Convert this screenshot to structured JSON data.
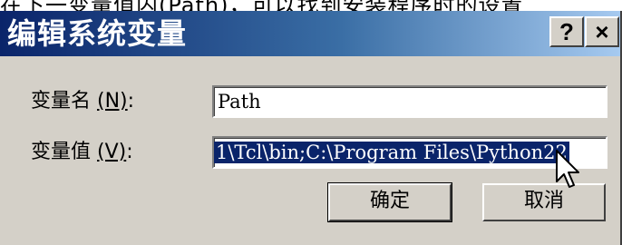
{
  "background_text": "在下一变量值内(Path)，可以找到安装程序时的设置",
  "dialog": {
    "title": "编辑系统变量",
    "help_label": "?",
    "close_label": "×"
  },
  "fields": {
    "name_label": "变量名",
    "name_mnemonic": "(N)",
    "name_colon": ":",
    "name_value": "Path",
    "value_label": "变量值",
    "value_mnemonic": "(V)",
    "value_colon": ":",
    "value_value": "1\\Tcl\\bin;C:\\Program Files\\Python22"
  },
  "buttons": {
    "ok": "确定",
    "cancel": "取消"
  },
  "colors": {
    "title_start": "#0a246a",
    "title_end": "#a6caf0",
    "selection": "#0a246a",
    "face": "#d4d0c8"
  },
  "icons": {
    "cursor": "mouse-pointer-icon"
  }
}
